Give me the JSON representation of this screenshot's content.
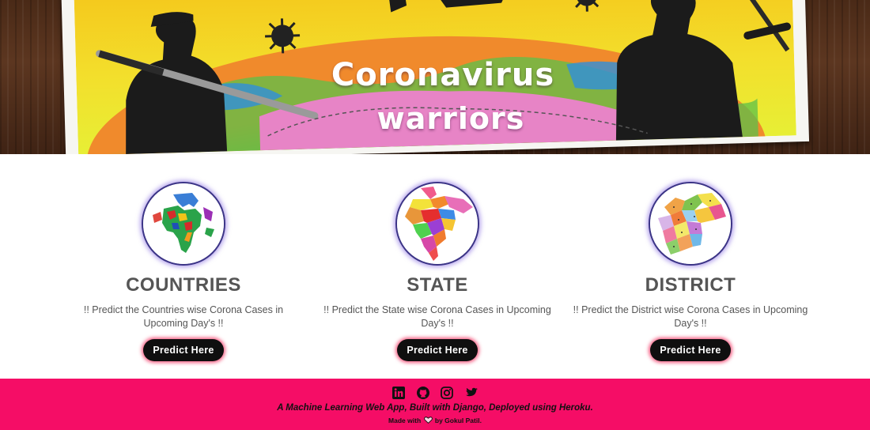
{
  "banner": {
    "title_line1": "Coronavirus",
    "title_line2": "warriors"
  },
  "cards": [
    {
      "title": "COUNTRIES",
      "description": "!! Predict the Countries wise Corona Cases in Upcoming Day's !!",
      "button_label": "Predict Here",
      "image": "world-map-icon"
    },
    {
      "title": "STATE",
      "description": "!! Predict the State wise Corona Cases in Upcoming Day's !!",
      "button_label": "Predict Here",
      "image": "india-map-icon"
    },
    {
      "title": "DISTRICT",
      "description": "!! Predict the District wise Corona Cases in Upcoming Day's !!",
      "button_label": "Predict Here",
      "image": "district-map-icon"
    }
  ],
  "footer": {
    "social_icons": [
      "linkedin-icon",
      "github-icon",
      "instagram-icon",
      "twitter-icon"
    ],
    "tagline": "A Machine Learning Web App, Built with Django, Deployed using Heroku.",
    "made_prefix": "Made with",
    "made_suffix": "by Gokul Patil."
  },
  "colors": {
    "footer_bg": "#f50d66",
    "button_bg": "#0f0f0f",
    "button_glow": "#f0285a",
    "card_ring": "#3b3486",
    "heading_text": "#555555"
  }
}
